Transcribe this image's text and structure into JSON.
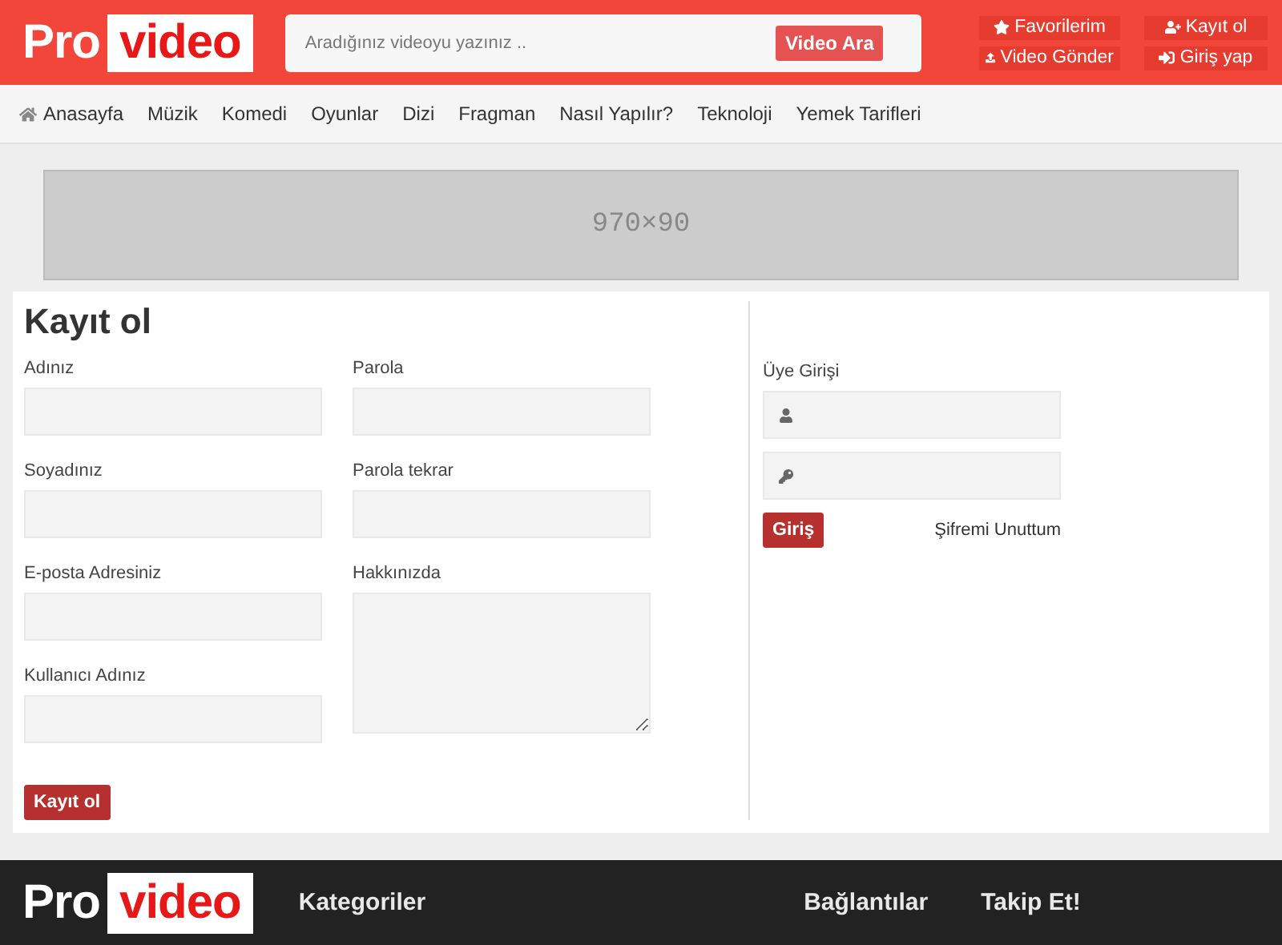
{
  "header": {
    "logo": {
      "part_1": "Pro",
      "part_2": "video"
    },
    "search": {
      "placeholder": "Aradığınız videoyu yazınız ..",
      "button": "Video Ara"
    },
    "actions": [
      {
        "label": "Favorilerim"
      },
      {
        "label": "Kayıt ol"
      },
      {
        "label": "Video Gönder"
      },
      {
        "label": "Giriş yap"
      }
    ]
  },
  "nav": [
    {
      "label": "Anasayfa"
    },
    {
      "label": "Müzik"
    },
    {
      "label": "Komedi"
    },
    {
      "label": "Oyunlar"
    },
    {
      "label": "Dizi"
    },
    {
      "label": "Fragman"
    },
    {
      "label": "Nasıl Yapılır?"
    },
    {
      "label": "Teknoloji"
    },
    {
      "label": "Yemek Tarifleri"
    }
  ],
  "ad": {
    "label": "970×90"
  },
  "register": {
    "title": "Kayıt ol",
    "left_fields": [
      {
        "label": "Adınız",
        "kind": "input"
      },
      {
        "label": "Soyadınız",
        "kind": "input"
      },
      {
        "label": "E-posta Adresiniz",
        "kind": "input"
      },
      {
        "label": "Kullanıcı Adınız",
        "kind": "input"
      }
    ],
    "right_fields": [
      {
        "label": "Parola",
        "kind": "input"
      },
      {
        "label": "Parola tekrar",
        "kind": "input"
      },
      {
        "label": "Hakkınızda",
        "kind": "textarea"
      }
    ],
    "button": "Kayıt ol"
  },
  "login": {
    "title": "Üye Girişi",
    "button": "Giriş",
    "forgot": "Şifremi Unuttum"
  },
  "footer": {
    "logo": {
      "part_1": "Pro",
      "part_2": "video"
    },
    "headings": [
      "Kategoriler",
      "Bağlantılar",
      "Takip Et!"
    ]
  }
}
